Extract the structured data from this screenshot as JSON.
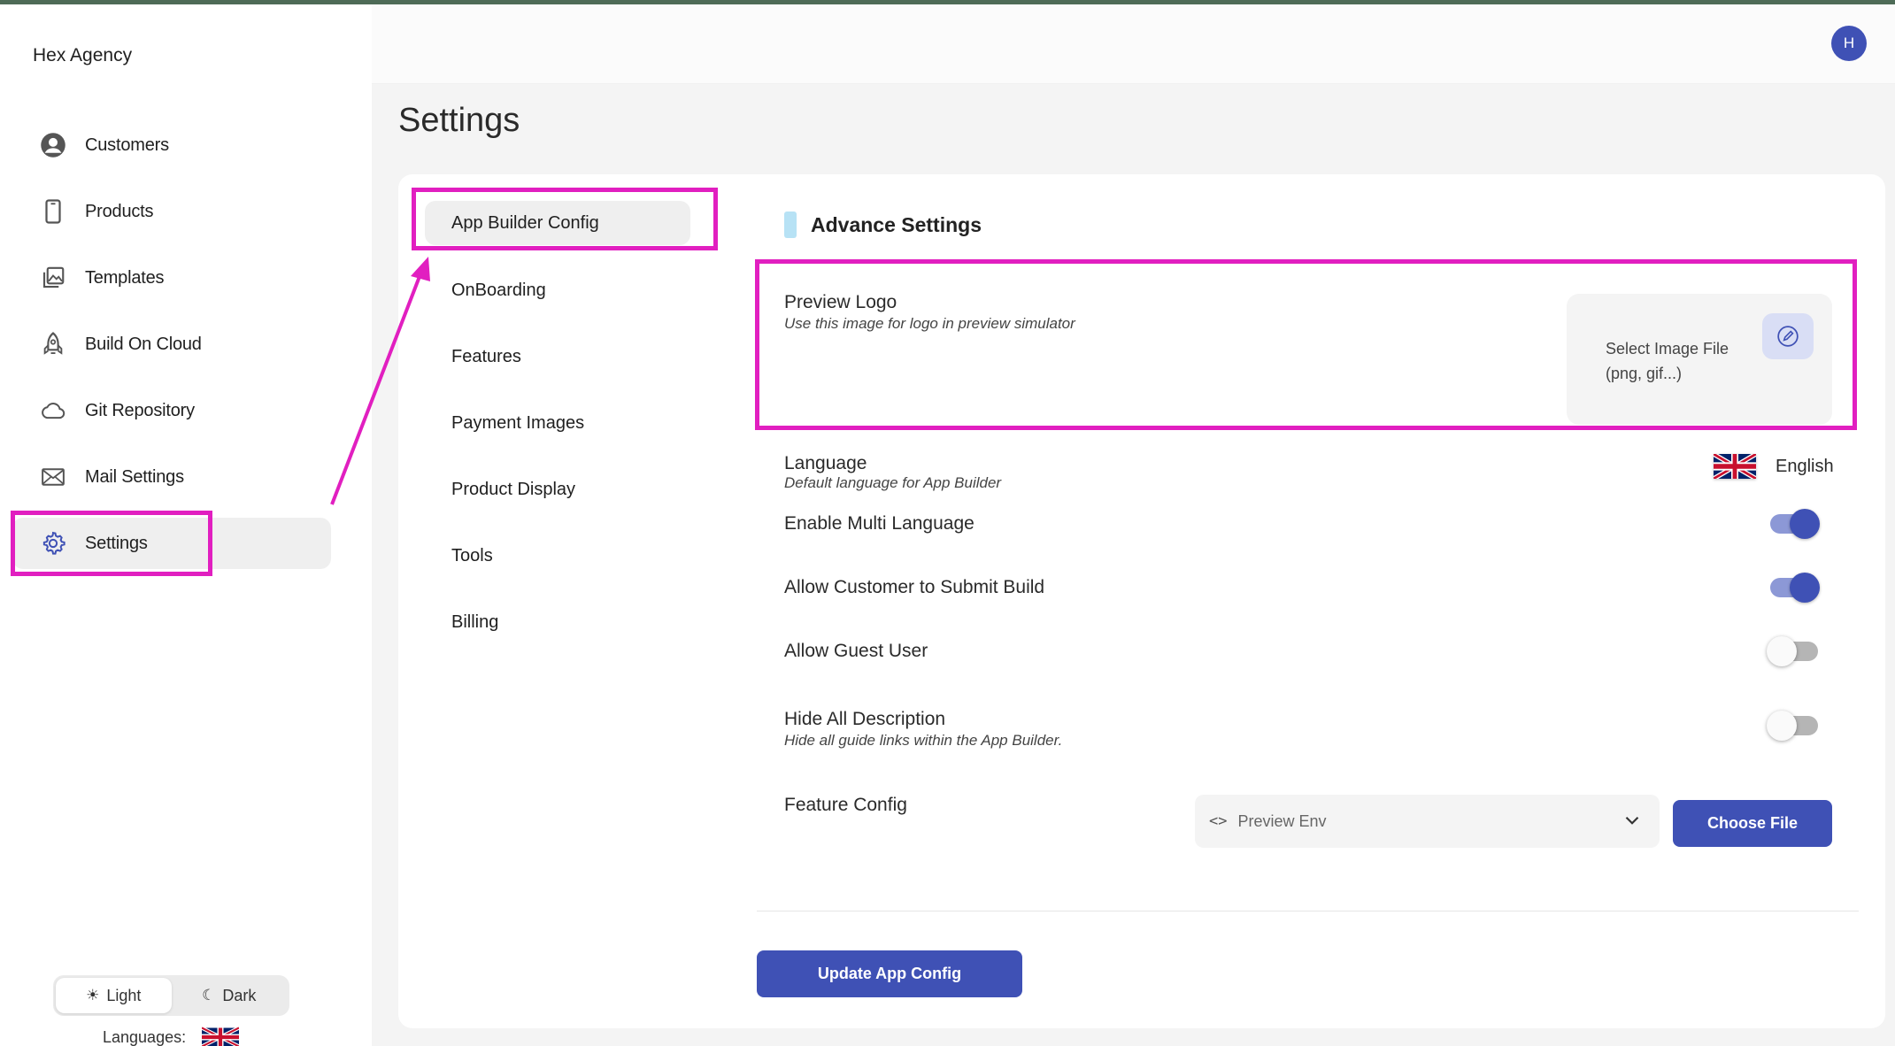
{
  "app": {
    "brand": "Hex Agency",
    "avatar_initial": "H"
  },
  "sidebar": {
    "items": [
      {
        "label": "Customers",
        "icon": "user-circle-icon"
      },
      {
        "label": "Products",
        "icon": "phone-icon"
      },
      {
        "label": "Templates",
        "icon": "images-icon"
      },
      {
        "label": "Build On Cloud",
        "icon": "rocket-icon"
      },
      {
        "label": "Git Repository",
        "icon": "cloud-icon"
      },
      {
        "label": "Mail Settings",
        "icon": "envelope-icon"
      },
      {
        "label": "Settings",
        "icon": "gear-icon",
        "active": true
      }
    ],
    "theme": {
      "light": "Light",
      "dark": "Dark",
      "selected": "Light"
    },
    "languages_label": "Languages:"
  },
  "page": {
    "title": "Settings"
  },
  "submenu": {
    "items": [
      "App Builder Config",
      "OnBoarding",
      "Features",
      "Payment Images",
      "Product Display",
      "Tools",
      "Billing"
    ],
    "active": "App Builder Config"
  },
  "advance": {
    "title": "Advance Settings",
    "preview_logo": {
      "label": "Preview Logo",
      "desc": "Use this image for logo in preview simulator",
      "upload_line1": "Select Image File",
      "upload_line2": "(png, gif...)"
    },
    "language": {
      "label": "Language",
      "desc": "Default language for App Builder",
      "value": "English"
    },
    "multi_language": {
      "label": "Enable Multi Language",
      "on": true
    },
    "submit_build": {
      "label": "Allow Customer to Submit Build",
      "on": true
    },
    "guest_user": {
      "label": "Allow Guest User",
      "on": false
    },
    "hide_desc": {
      "label": "Hide All Description",
      "desc": "Hide all guide links within the App Builder.",
      "on": false
    },
    "feature_config": {
      "label": "Feature Config",
      "select_value": "Preview Env",
      "choose_file": "Choose File"
    },
    "update_button": "Update App Config"
  },
  "colors": {
    "primary": "#3f51b5",
    "highlight": "#e11fc0",
    "accent_bar": "#b7e2f5"
  }
}
